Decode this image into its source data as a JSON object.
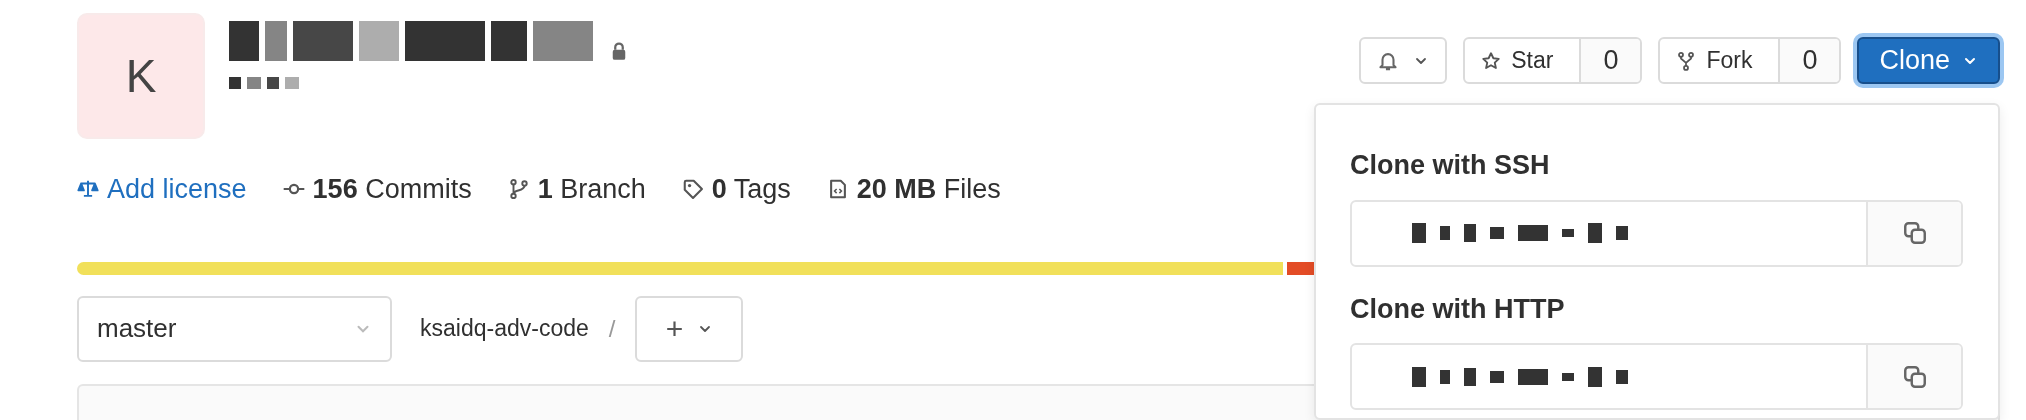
{
  "project": {
    "avatar_letter": "K",
    "private": true
  },
  "stats": [
    {
      "kind": "license",
      "label": "Add license"
    },
    {
      "kind": "commits",
      "count": "156",
      "label": "Commits"
    },
    {
      "kind": "branch",
      "count": "1",
      "label": "Branch"
    },
    {
      "kind": "tags",
      "count": "0",
      "label": "Tags"
    },
    {
      "kind": "files",
      "count": "20 MB",
      "label": "Files"
    }
  ],
  "actions": {
    "star": {
      "label": "Star",
      "count": "0"
    },
    "fork": {
      "label": "Fork",
      "count": "0"
    },
    "clone": {
      "label": "Clone",
      "expanded": true
    }
  },
  "language_bar": [
    {
      "color": "#f1e05a"
    },
    {
      "color": "#e34c26"
    }
  ],
  "branch_select": {
    "value": "master"
  },
  "breadcrumb": {
    "path": "ksaidq-adv-code",
    "separator": "/",
    "add_label": "+"
  },
  "clone_menu": [
    {
      "heading": "Clone with SSH"
    },
    {
      "heading": "Clone with HTTP"
    }
  ]
}
